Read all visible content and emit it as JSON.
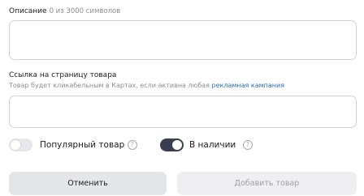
{
  "description": {
    "label": "Описание",
    "counter": "0 из 3000 символов",
    "value": ""
  },
  "product_link": {
    "label": "Ссылка на страницу товара",
    "hint_text": "Товар будет кликабельным в Картах, если активна любая ",
    "hint_link": "рекламная кампания",
    "value": ""
  },
  "toggles": {
    "popular": {
      "label": "Популярный товар",
      "checked": false,
      "help_glyph": "?"
    },
    "in_stock": {
      "label": "В наличии",
      "checked": true,
      "help_glyph": "?"
    }
  },
  "buttons": {
    "cancel": "Отменить",
    "add": "Добавить товар"
  },
  "colors": {
    "toggle_on": "#3a3f4f",
    "link": "#2970c2",
    "muted_text": "#8d8d96"
  },
  "icons": {
    "help": "question-circle-icon"
  }
}
